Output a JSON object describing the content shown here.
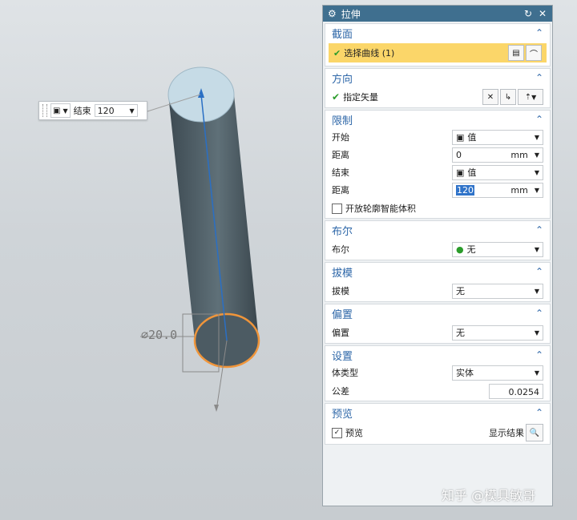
{
  "floating_toolbar": {
    "end_label": "结束",
    "end_value": "120"
  },
  "viewport": {
    "dimension_text": "∅20.0"
  },
  "dialog": {
    "title": "拉伸",
    "sections": {
      "section": {
        "title": "截面",
        "select_curve": "选择曲线 (1)"
      },
      "direction": {
        "title": "方向",
        "specify_vector": "指定矢量"
      },
      "limits": {
        "title": "限制",
        "start_label": "开始",
        "start_value": "值",
        "dist1_label": "距离",
        "dist1_value": "0",
        "dist1_unit": "mm",
        "end_label": "结束",
        "end_value": "值",
        "dist2_label": "距离",
        "dist2_value": "120",
        "dist2_unit": "mm",
        "open_profile": "开放轮廓智能体积"
      },
      "boolean": {
        "title": "布尔",
        "label": "布尔",
        "value": "无"
      },
      "draft": {
        "title": "拔模",
        "label": "拔模",
        "value": "无"
      },
      "offset": {
        "title": "偏置",
        "label": "偏置",
        "value": "无"
      },
      "settings": {
        "title": "设置",
        "body_type_label": "体类型",
        "body_type_value": "实体",
        "tolerance_label": "公差",
        "tolerance_value": "0.0254"
      },
      "preview": {
        "title": "预览",
        "preview_label": "预览",
        "show_result": "显示结果"
      }
    }
  },
  "watermark": "知乎 @模具敏哥"
}
